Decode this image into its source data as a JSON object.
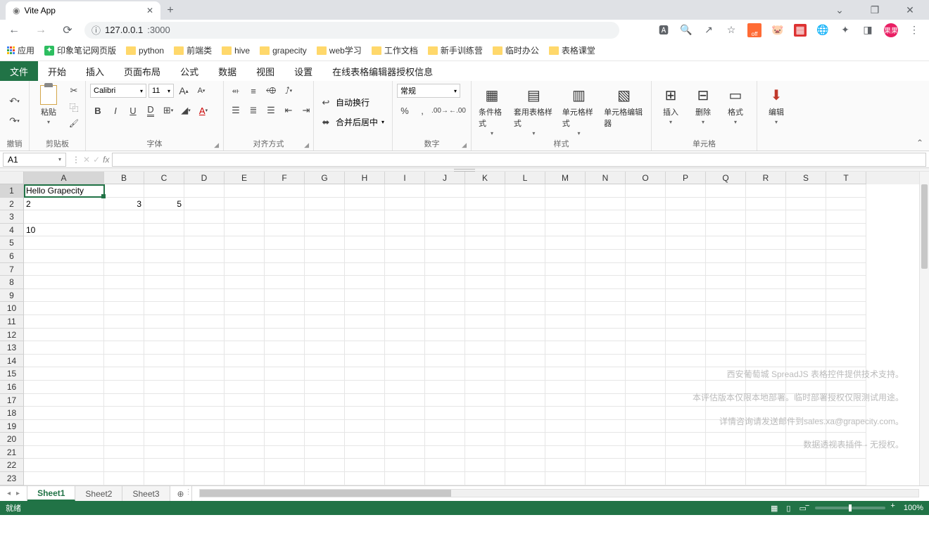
{
  "browser": {
    "tab_title": "Vite App",
    "url_host": "127.0.0.1",
    "url_port": ":3000",
    "window_controls": {
      "min": "⌄",
      "max": "❐",
      "close": "✕"
    }
  },
  "addr_icons": [
    "translate",
    "search",
    "share",
    "star"
  ],
  "extensions_tail": [
    "globe",
    "puzzle",
    "panel"
  ],
  "bookmarks": {
    "apps": "应用",
    "items": [
      "印象笔记网页版",
      "python",
      "前端类",
      "hive",
      "grapecity",
      "web学习",
      "工作文档",
      "新手训练营",
      "临时办公",
      "表格课堂"
    ]
  },
  "ribbon": {
    "tabs": [
      "文件",
      "开始",
      "插入",
      "页面布局",
      "公式",
      "数据",
      "视图",
      "设置",
      "在线表格编辑器授权信息"
    ],
    "active_index": 0,
    "groups": {
      "undo": "撤销",
      "clipboard": "剪贴板",
      "paste": "粘贴",
      "font": "字体",
      "font_name": "Calibri",
      "font_size": "11",
      "align": "对齐方式",
      "wrap": "自动换行",
      "merge": "合并后居中",
      "number": "数字",
      "number_format": "常规",
      "styles": "样式",
      "cond_fmt": "条件格式",
      "table_fmt": "套用表格样式",
      "cell_style": "单元格样式",
      "cell_editor": "单元格编辑器",
      "cells_label": "单元格",
      "insert": "插入",
      "delete": "删除",
      "format": "格式",
      "editing": "编辑"
    }
  },
  "name_box": "A1",
  "columns": [
    "A",
    "B",
    "C",
    "D",
    "E",
    "F",
    "G",
    "H",
    "I",
    "J",
    "K",
    "L",
    "M",
    "N",
    "O",
    "P",
    "Q",
    "R",
    "S",
    "T"
  ],
  "row_count": 23,
  "cells": {
    "A1": "Hello Grapecity",
    "A2": "2",
    "B2": "3",
    "C2": "5",
    "A4": "10"
  },
  "watermark": [
    "西安葡萄城 SpreadJS 表格控件提供技术支持。",
    "本评估版本仅限本地部署。临时部署授权仅限测试用途。",
    "详情咨询请发送邮件到sales.xa@grapecity.com。",
    "数据透视表插件 - 无授权。"
  ],
  "sheets": [
    "Sheet1",
    "Sheet2",
    "Sheet3"
  ],
  "active_sheet": 0,
  "status": {
    "ready": "就绪",
    "zoom": "100%"
  },
  "avatar_text": "果果"
}
